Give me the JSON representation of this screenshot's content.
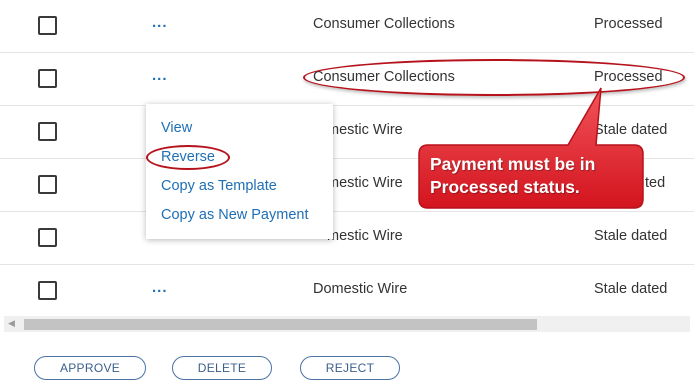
{
  "rows": [
    {
      "actions_label": "...",
      "type": "Consumer Collections",
      "status": "Processed"
    },
    {
      "actions_label": "...",
      "type": "Consumer Collections",
      "status": "Processed"
    },
    {
      "actions_label": "...",
      "type": "Domestic Wire",
      "status": "Stale dated"
    },
    {
      "actions_label": "...",
      "type": "Domestic Wire",
      "status": "Stale dated"
    },
    {
      "actions_label": "...",
      "type": "Domestic Wire",
      "status": "Stale dated"
    },
    {
      "actions_label": "...",
      "type": "Domestic Wire",
      "status": "Stale dated"
    }
  ],
  "visible_type_text": {
    "row3": "mestic Wire",
    "row4": "mestic Wire",
    "row5": "mestic Wire"
  },
  "visible_status_text": {
    "row4": "ted"
  },
  "context_menu": {
    "items": [
      "View",
      "Reverse",
      "Copy as Template",
      "Copy as New Payment"
    ]
  },
  "callout": {
    "text": "Payment must be in Processed status.",
    "color": "#e8202a"
  },
  "buttons": {
    "approve": "APPROVE",
    "delete": "DELETE",
    "reject": "REJECT"
  },
  "colors": {
    "link": "#1f6fb6",
    "highlight": "#b5121b"
  }
}
